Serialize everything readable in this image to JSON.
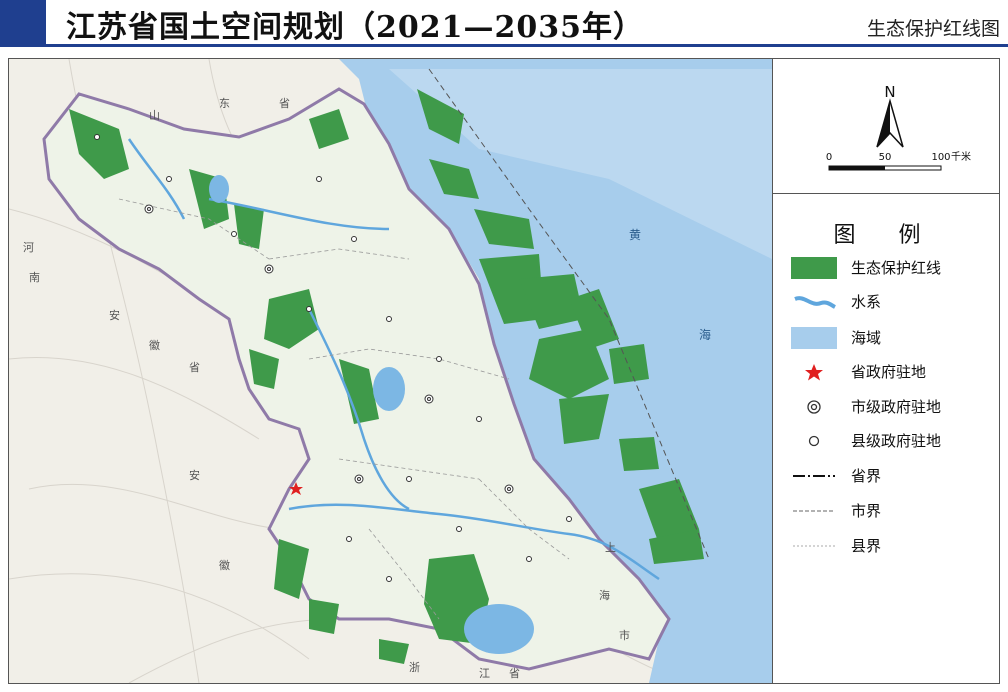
{
  "header": {
    "title": "江苏省国土空间规划（2021—2035年）",
    "subtitle": "生态保护红线图"
  },
  "colors": {
    "title_accent": "#1f3f8f",
    "ecological_redline": "#3f9a4a",
    "land": "#f3f1ea",
    "province_land": "#eef3e8",
    "sea": "#a7cdec",
    "water": "#5fa6dd",
    "capital_star": "#e02020",
    "province_boundary": "#8f7aa8"
  },
  "compass": {
    "label": "N"
  },
  "scale_bar": {
    "ticks": [
      "0",
      "50",
      "100"
    ],
    "unit": "千米"
  },
  "legend": {
    "title": "图 例",
    "items": [
      {
        "label": "生态保护红线",
        "icon": "green-fill-swatch"
      },
      {
        "label": "水系",
        "icon": "river-swatch"
      },
      {
        "label": "海域",
        "icon": "sea-swatch"
      },
      {
        "label": "省政府驻地",
        "icon": "red-star-icon"
      },
      {
        "label": "市级政府驻地",
        "icon": "double-circle-icon"
      },
      {
        "label": "县级政府驻地",
        "icon": "circle-icon"
      },
      {
        "label": "省界",
        "icon": "dash-dot-line"
      },
      {
        "label": "市界",
        "icon": "dashed-line"
      },
      {
        "label": "县界",
        "icon": "dotted-line"
      }
    ]
  },
  "map": {
    "neighbor_labels": [
      "山",
      "东",
      "省",
      "河",
      "南",
      "安",
      "徽",
      "省",
      "安",
      "徽",
      "上",
      "海",
      "市",
      "浙",
      "江",
      "省"
    ],
    "sea_labels": [
      "黄",
      "海"
    ]
  }
}
